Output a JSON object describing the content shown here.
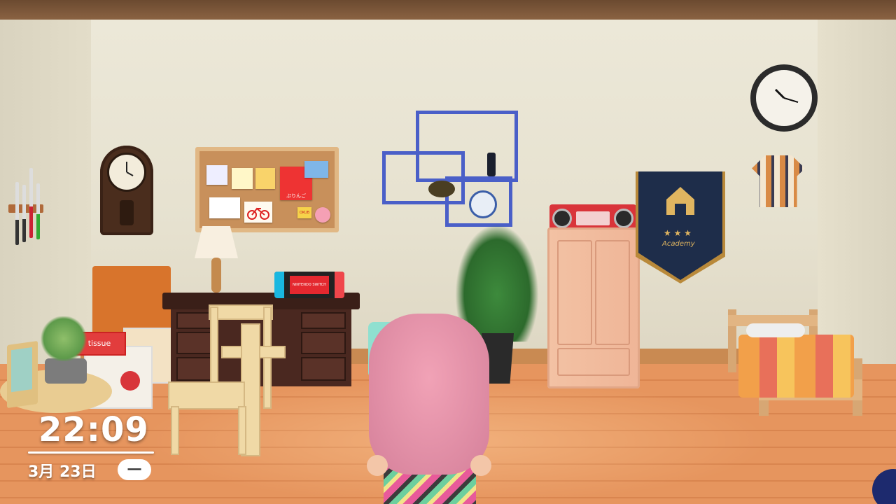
{
  "hud": {
    "time": "22:09",
    "date": "3月 23日",
    "weekday": "一"
  },
  "scene": {
    "switch_logo": "NINTENDO SWITCH",
    "tissue_box_label": "tissue",
    "cork_board_apple_card": "ぷりんご",
    "cork_board_sticker": "OKUB",
    "pennant_script": "Academy"
  },
  "colors": {
    "hair": "#e38aa5",
    "wall": "#e8e3d2",
    "floor": "#e39360",
    "shelf": "#4a5fc8",
    "radio": "#d9343a",
    "wardrobe": "#f0bb9c",
    "pennant": "#1e2d4a"
  }
}
